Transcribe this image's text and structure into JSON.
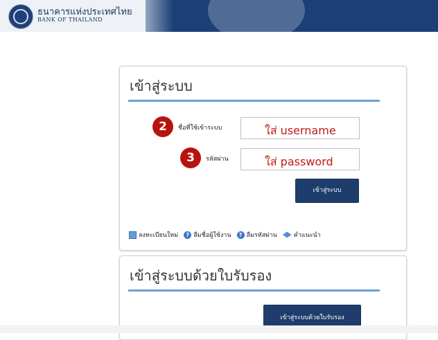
{
  "header": {
    "bank_name_th": "ธนาคารแห่งประเทศไทย",
    "bank_name_en": "BANK OF THAILAND",
    "logo_icon": "bank-seal-icon",
    "brand_color": "#1c3f78"
  },
  "login_panel": {
    "title": "เข้าสู่ระบบ",
    "username": {
      "step": "2",
      "label": "ชื่อที่ใช้เข้าระบบ",
      "value": "ใส่ username"
    },
    "password": {
      "step": "3",
      "label": "รหัสผ่าน",
      "value": "ใส่ password"
    },
    "submit_label": "เข้าสู่ระบบ",
    "links": [
      {
        "icon": "register-icon",
        "label": "ลงทะเบียนใหม่"
      },
      {
        "icon": "help-icon",
        "label": "ลืมชื่อผู้ใช้งาน"
      },
      {
        "icon": "help-icon",
        "label": "ลืมรหัสผ่าน"
      },
      {
        "icon": "tip-icon",
        "label": "คำแนะนำ"
      }
    ]
  },
  "cert_panel": {
    "title": "เข้าสู่ระบบด้วยใบรับรอง",
    "button_label": "เข้าสู่ระบบด้วยใบรับรอง"
  },
  "colors": {
    "accent_rule": "#6ea0d4",
    "button": "#1f3d6c",
    "badge": "#b7140e",
    "annotation_text": "#c01a16"
  }
}
